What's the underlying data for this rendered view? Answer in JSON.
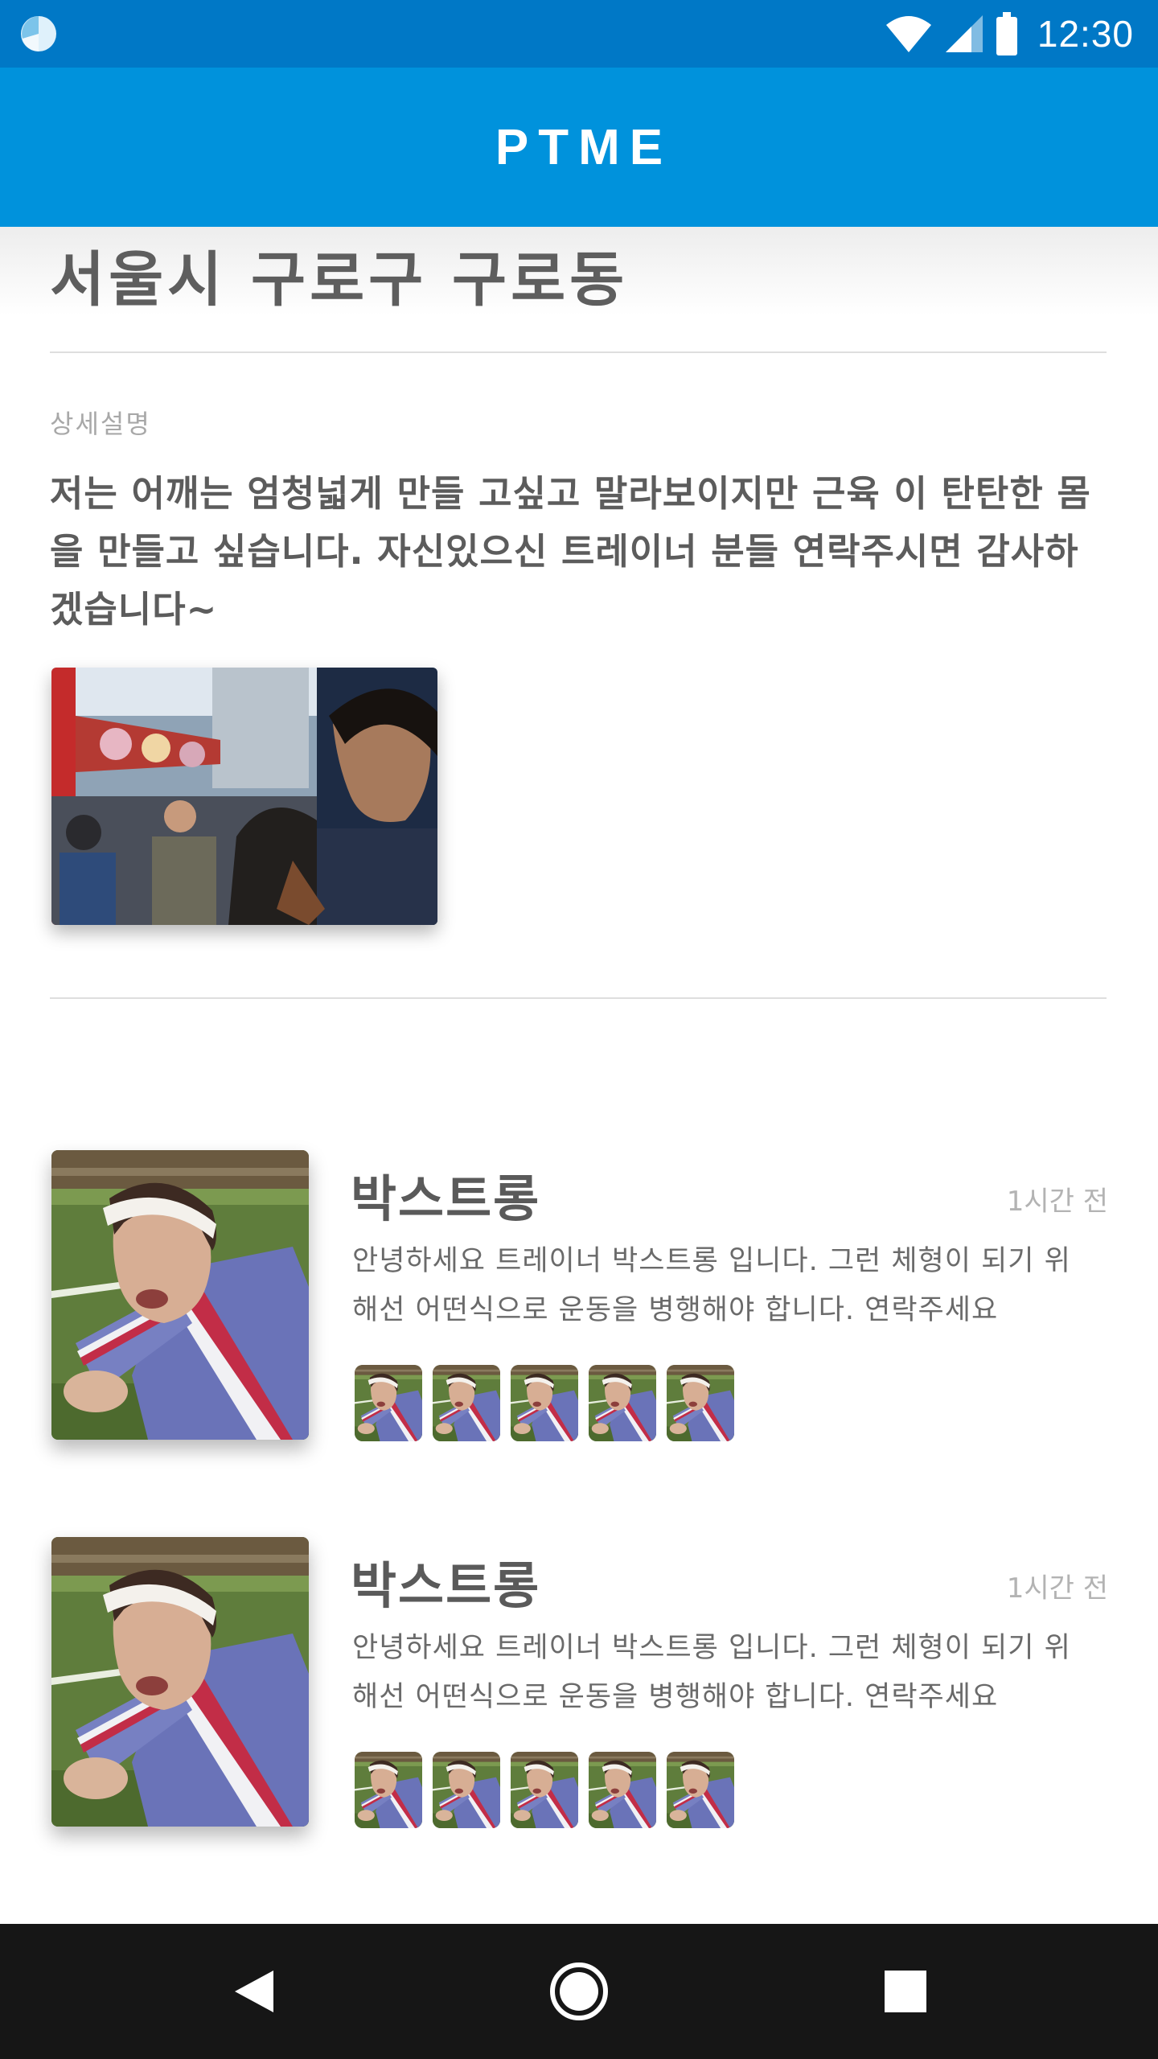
{
  "status_bar": {
    "time": "12:30",
    "icons": [
      "app-logo-icon",
      "wifi-icon",
      "signal-icon",
      "battery-icon"
    ]
  },
  "app_bar": {
    "title": "PTME"
  },
  "post": {
    "location": "서울시 구로구 구로동",
    "section_label": "상세설명",
    "description": "저는 어깨는 엄청넓게 만들 고싶고 말라보이지만 근육 이 탄탄한 몸을 만들고 싶습니다. 자신있으신 트레이너 분들 연락주시면 감사하겠습니다~"
  },
  "trainers": [
    {
      "name": "박스트롱",
      "time": "1시간 전",
      "message": "안녕하세요 트레이너 박스트롱 입니다.  그런 체형이 되기 위해선 어떤식으로 운동을 병행해야 합니다. 연락주세요"
    },
    {
      "name": "박스트롱",
      "time": "1시간 전",
      "message": "안녕하세요 트레이너 박스트롱 입니다.  그런 체형이 되기 위해선 어떤식으로 운동을 병행해야 합니다. 연락주세요"
    }
  ],
  "nav_bar": {
    "icons": [
      "back-icon",
      "home-icon",
      "recents-icon"
    ]
  },
  "colors": {
    "status_bar": "#0078c6",
    "app_bar": "#0092dc",
    "nav_bar": "#161616"
  }
}
